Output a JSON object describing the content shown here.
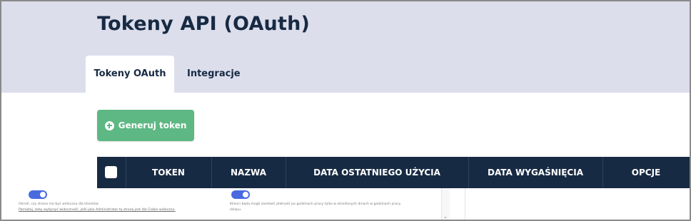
{
  "page": {
    "title": "Tokeny API (OAuth)"
  },
  "tabs": [
    {
      "label": "Tokeny OAuth",
      "active": true
    },
    {
      "label": "Integracje",
      "active": false
    }
  ],
  "actions": {
    "generate_label": "Generuj token",
    "generate_icon": "plus-circle-icon"
  },
  "table": {
    "columns": [
      "TOKEN",
      "NAZWA",
      "DATA OSTATNIEGO UŻYCIA",
      "DATA WYGAŚNIĘCIA",
      "OPCJE"
    ]
  },
  "overlay": {
    "left_text_1": "Określ, czy strona ma być widoczna dla klientów.",
    "left_text_2": "Pamiętaj, żeby wyłączyć widoczność, jeśli jako Administrator tą stronę jest dla Ciebie widoczna.",
    "right_text_1": "Klienci będą mogli zamówić płatność po godzinach pracy tylko w określonych dniach w godzinach pracy",
    "right_text_2": "sklepu."
  },
  "colors": {
    "header_bg": "#dcdeec",
    "title": "#172a43",
    "table_head_bg": "#172a43",
    "button_bg": "#5db883",
    "toggle": "#4a6be0"
  }
}
